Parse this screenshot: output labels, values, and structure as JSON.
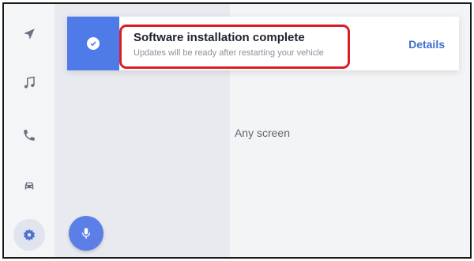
{
  "sidebar": {
    "items": [
      {
        "icon": "navigation-icon",
        "active": false
      },
      {
        "icon": "music-icon",
        "active": false
      },
      {
        "icon": "phone-icon",
        "active": false
      },
      {
        "icon": "car-icon",
        "active": false
      },
      {
        "icon": "gear-icon",
        "active": true
      }
    ]
  },
  "main": {
    "screen_label": "Any screen"
  },
  "voice": {
    "icon": "microphone-icon"
  },
  "notification": {
    "icon": "check-circle-icon",
    "title": "Software installation complete",
    "subtitle": "Updates will be ready after restarting your vehicle",
    "action_label": "Details",
    "highlighted": true
  },
  "colors": {
    "accent": "#4f7be8",
    "link": "#3e6fd0",
    "highlight": "#d81f26",
    "sidebar_bg": "#f4f5f7",
    "left_pane_bg": "#e8eaef"
  }
}
